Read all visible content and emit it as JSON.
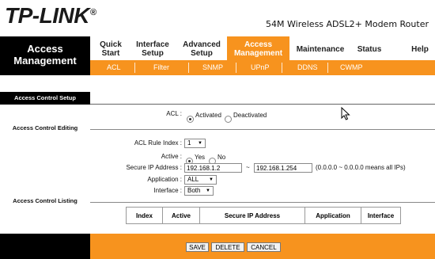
{
  "header": {
    "logo_text": "TP-LINK",
    "logo_reg": "®",
    "model": "54M Wireless ADSL2+ Modem Router"
  },
  "nav": {
    "section_title": "Access Management",
    "tabs": [
      {
        "label": "Quick Start"
      },
      {
        "label": "Interface Setup"
      },
      {
        "label": "Advanced Setup"
      },
      {
        "label": "Access Management",
        "active": true
      },
      {
        "label": "Maintenance"
      },
      {
        "label": "Status"
      },
      {
        "label": "Help"
      }
    ],
    "subtabs": [
      "ACL",
      "Filter",
      "SNMP",
      "UPnP",
      "DDNS",
      "CWMP"
    ],
    "accent_color": "#f7931e"
  },
  "left": {
    "setup": "Access Control Setup",
    "editing": "Access Control Editing",
    "listing": "Access Control Listing"
  },
  "form": {
    "acl_label": "ACL :",
    "acl_activated": "Activated",
    "acl_deactivated": "Deactivated",
    "acl_state": "Activated",
    "rule_index_label": "ACL Rule Index :",
    "rule_index_value": "1",
    "active_label": "Active :",
    "active_yes": "Yes",
    "active_no": "No",
    "secure_ip_label": "Secure IP Address :",
    "ip_start": "192.168.1.2",
    "ip_tilde": "~",
    "ip_end": "192.168.1.254",
    "ip_note": "(0.0.0.0 ~ 0.0.0.0 means all IPs)",
    "application_label": "Application :",
    "application_value": "ALL",
    "interface_label": "Interface :",
    "interface_value": "Both"
  },
  "table": {
    "headers": [
      "Index",
      "Active",
      "Secure IP Address",
      "Application",
      "Interface"
    ]
  },
  "buttons": {
    "save": "SAVE",
    "delete": "DELETE",
    "cancel": "CANCEL"
  }
}
